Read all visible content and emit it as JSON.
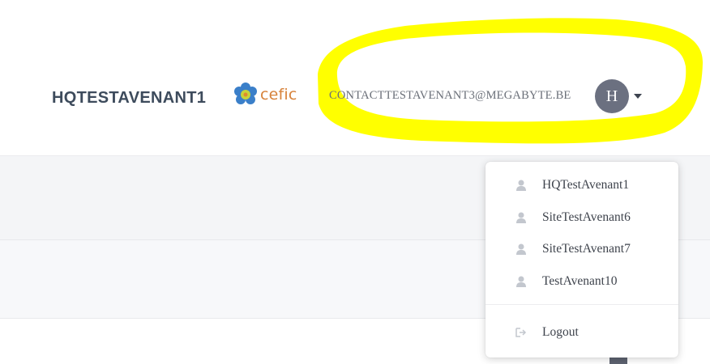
{
  "header": {
    "org_name": "HQTESTAVENANT1",
    "logo_text": "cefic",
    "user_email": "CONTACTTESTAVENANT3@MEGABYTE.BE",
    "avatar_initial": "H"
  },
  "user_menu": {
    "items": [
      {
        "label": "HQTestAvenant1",
        "icon": "user-icon"
      },
      {
        "label": "SiteTestAvenant6",
        "icon": "user-icon"
      },
      {
        "label": "SiteTestAvenant7",
        "icon": "user-icon"
      },
      {
        "label": "TestAvenant10",
        "icon": "user-icon"
      }
    ],
    "logout_label": "Logout",
    "logout_icon": "logout-icon"
  },
  "colors": {
    "highlight": "#ffff00",
    "logo_accent": "#d7823a",
    "logo_flower": "#3a7fc9",
    "avatar_bg": "#6b7080"
  }
}
